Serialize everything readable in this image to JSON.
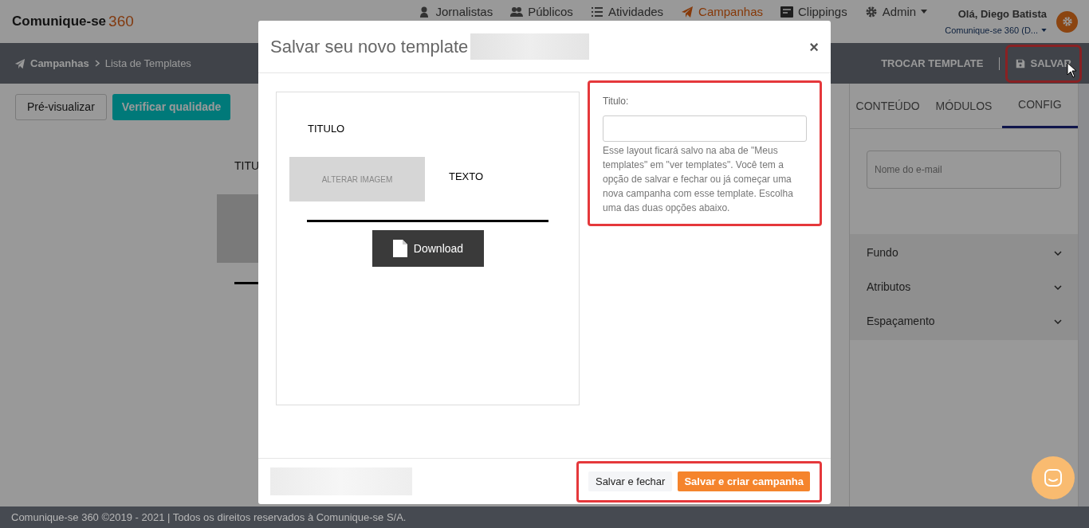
{
  "header": {
    "logo_text": "Comunique-se",
    "logo_number": "360",
    "nav": [
      {
        "label": "Jornalistas",
        "selected": false
      },
      {
        "label": "Públicos",
        "selected": false
      },
      {
        "label": "Atividades",
        "selected": false
      },
      {
        "label": "Campanhas",
        "selected": true
      },
      {
        "label": "Clippings",
        "selected": false
      },
      {
        "label": "Admin",
        "selected": false
      }
    ],
    "greeting": "Olá, Diego Batista",
    "account": "Comunique-se 360 (D..."
  },
  "breadcrumb": [
    "Campanhas",
    "Lista de Templates"
  ],
  "toolbar_actions": [
    {
      "label": "TROCAR TEMPLATE",
      "highlighted": false
    },
    {
      "label": "SALVAR",
      "highlighted": true
    }
  ],
  "editor_buttons": [
    "Pré-visualizar",
    "Verificar qualidade"
  ],
  "canvas_title": "TITU",
  "side_panel": {
    "tabs": [
      {
        "label": "CONTEÚDO",
        "selected": false
      },
      {
        "label": "MÓDULOS",
        "selected": false
      },
      {
        "label": "CONFIG",
        "selected": true
      }
    ],
    "email_name_placeholder": "Nome do e-mail",
    "sections": [
      "Fundo",
      "Atributos",
      "Espaçamento"
    ]
  },
  "modal": {
    "title": "Salvar seu novo template",
    "close": "×",
    "preview": {
      "title": "TITULO",
      "image_label": "ALTERAR IMAGEM",
      "text": "TEXTO",
      "button": "Download"
    },
    "form": {
      "highlighted": true,
      "label": "Titulo:",
      "help": "Esse layout ficará salvo na aba de \"Meus templates\" em \"ver templates\". Você tem a opção de salvar e fechar ou já começar uma nova campanha com esse template. Escolha uma das duas opções abaixo."
    },
    "actions": {
      "highlighted": true,
      "buttons": [
        {
          "label": "Salvar e fechar",
          "kind": "secondary"
        },
        {
          "label": "Salvar e criar campanha",
          "kind": "primary"
        }
      ]
    }
  },
  "footer": "Comunique-se 360 ©2019 - 2021 | Todos os direitos reservados à Comunique-se S/A."
}
